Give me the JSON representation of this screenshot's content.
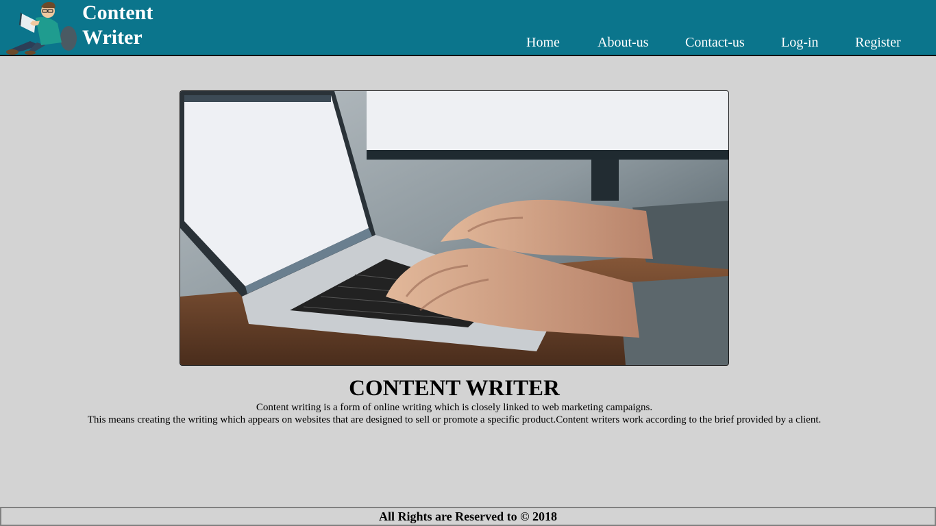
{
  "brand": {
    "line1": "Content",
    "line2": "Writer",
    "logo_icon": "reading-person-icon"
  },
  "nav": {
    "items": [
      {
        "label": "Home"
      },
      {
        "label": "About-us"
      },
      {
        "label": "Contact-us"
      },
      {
        "label": "Log-in"
      },
      {
        "label": "Register"
      }
    ]
  },
  "hero": {
    "image": "laptop-typing-photo"
  },
  "main": {
    "title": "CONTENT WRITER",
    "description_line1": "Content writing is a form of online writing which is closely linked to web marketing campaigns.",
    "description_line2": "This means creating the writing which appears on websites that are designed to sell or promote a specific product.Content writers work according to the brief provided by a client."
  },
  "footer": {
    "text": "All Rights are Reserved to © 2018"
  },
  "colors": {
    "header_bg": "#0b758c",
    "page_bg": "#d3d3d3",
    "footer_border": "#808080"
  }
}
